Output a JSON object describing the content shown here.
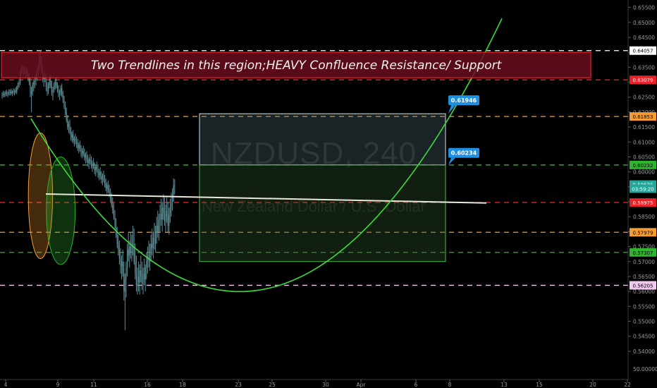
{
  "chart_data": {
    "type": "candlestick",
    "title": "NZDUSD, 240",
    "subtitle": "New Zealand Dollar / U.S. Dollar",
    "symbol": "NZDUSD",
    "interval": "240",
    "ylim": [
      0.5375,
      0.6575
    ],
    "y_scale_break_label": "50.00000",
    "y_ticks": [
      "0.65500",
      "0.65000",
      "0.64500",
      "0.64000",
      "0.63500",
      "0.63000",
      "0.62500",
      "0.62000",
      "0.61500",
      "0.61000",
      "0.60500",
      "0.60000",
      "0.59500",
      "0.59000",
      "0.58500",
      "0.58000",
      "0.57500",
      "0.57000",
      "0.56500",
      "0.56000",
      "0.55500",
      "0.55000",
      "0.54500",
      "0.54000"
    ],
    "x_ticks": [
      "4",
      "9",
      "11",
      "16",
      "18",
      "23",
      "25",
      "30",
      "Apr",
      "6",
      "8",
      "13",
      "15",
      "20",
      "22"
    ],
    "x_tick_bar_index": [
      0,
      30,
      46,
      77,
      93,
      123,
      139,
      169,
      185,
      215,
      231,
      261,
      277,
      307,
      323
    ],
    "grid": false,
    "price_labels": [
      {
        "text": "0.64057",
        "value": 0.64057,
        "bg": "#ffffff",
        "fg": "#000000"
      },
      {
        "text": "0.63079",
        "value": 0.63079,
        "bg": "#e8232a",
        "fg": "#ffffff"
      },
      {
        "text": "0.61853",
        "value": 0.61853,
        "bg": "#f39c34",
        "fg": "#000000"
      },
      {
        "text": "0.60232",
        "value": 0.60232,
        "bg": "#2eb52e",
        "fg": "#000000"
      },
      {
        "text": "0.59576",
        "value": 0.59576,
        "bg": "#26a69a",
        "fg": "#ffffff"
      },
      {
        "text": "03:59:20",
        "value": 0.5944,
        "bg": "#26a69a",
        "fg": "#ffffff"
      },
      {
        "text": "0.58975",
        "value": 0.58975,
        "bg": "#e8232a",
        "fg": "#ffffff"
      },
      {
        "text": "0.57979",
        "value": 0.57979,
        "bg": "#f39c34",
        "fg": "#000000"
      },
      {
        "text": "0.57307",
        "value": 0.57307,
        "bg": "#2eb52e",
        "fg": "#000000"
      },
      {
        "text": "0.56205",
        "value": 0.56205,
        "bg": "#f2c7f0",
        "fg": "#000000"
      }
    ],
    "horizontal_levels": [
      {
        "value": 0.64057,
        "color": "#ffffff"
      },
      {
        "value": 0.63079,
        "color": "#e8232a"
      },
      {
        "value": 0.61853,
        "color": "#f39c34"
      },
      {
        "value": 0.60232,
        "color": "#2eb52e"
      },
      {
        "value": 0.58975,
        "color": "#e8232a"
      },
      {
        "value": 0.57979,
        "color": "#f39c34"
      },
      {
        "value": 0.57307,
        "color": "#2eb52e"
      },
      {
        "value": 0.56205,
        "color": "#f2c7f0"
      }
    ],
    "banner": {
      "text": "Two Trendlines in this region;HEAVY Confluence Resistance/ Support",
      "top": 0.64,
      "bottom": 0.6315
    },
    "callouts": [
      {
        "text": "0.61946",
        "value": 0.61946
      },
      {
        "text": "0.60234",
        "value": 0.60234
      }
    ],
    "measure_box": {
      "top": 0.61946,
      "mid": 0.60234,
      "bottom": 0.57,
      "x0_bar": 116,
      "x1_bar": 228
    },
    "trendline": {
      "x0_bar": 13,
      "v0": 0.5926,
      "x1_bar": 244,
      "v1": 0.5896
    },
    "parabola": {
      "vertex_bar": 119,
      "vertex_value": 0.55995,
      "points": [
        [
          10,
          0.6178
        ],
        [
          228,
          0.61946
        ],
        [
          255,
          0.6575
        ]
      ]
    },
    "ellipses": [
      {
        "cx_bar": 9,
        "cy": 0.592,
        "rx_bars": 7,
        "ry": 0.021,
        "color": "#f39c34"
      },
      {
        "cx_bar": 27,
        "cy": 0.587,
        "rx_bars": 9,
        "ry": 0.018,
        "color": "#2eb52e"
      }
    ],
    "candles": {
      "ohlc": [
        [
          0.6255,
          0.6266,
          0.6245,
          0.626
        ],
        [
          0.626,
          0.6271,
          0.625,
          0.6258
        ],
        [
          0.6258,
          0.6268,
          0.6249,
          0.6262
        ],
        [
          0.6262,
          0.6272,
          0.6252,
          0.6264
        ],
        [
          0.6264,
          0.6275,
          0.6254,
          0.626
        ],
        [
          0.626,
          0.6269,
          0.625,
          0.6266
        ],
        [
          0.6266,
          0.6276,
          0.6256,
          0.6265
        ],
        [
          0.6265,
          0.6276,
          0.6255,
          0.6268
        ],
        [
          0.6268,
          0.6279,
          0.6258,
          0.6263
        ],
        [
          0.6263,
          0.6273,
          0.6253,
          0.627
        ],
        [
          0.627,
          0.628,
          0.626,
          0.6266
        ],
        [
          0.6266,
          0.6277,
          0.6256,
          0.6272
        ],
        [
          0.6272,
          0.6283,
          0.6262,
          0.6268
        ],
        [
          0.6268,
          0.6288,
          0.626,
          0.6285
        ],
        [
          0.6285,
          0.63,
          0.6275,
          0.629
        ],
        [
          0.629,
          0.6305,
          0.6282,
          0.6298
        ],
        [
          0.6298,
          0.6342,
          0.629,
          0.6335
        ],
        [
          0.6335,
          0.6352,
          0.632,
          0.6345
        ],
        [
          0.6345,
          0.636,
          0.633,
          0.6338
        ],
        [
          0.6338,
          0.6352,
          0.6322,
          0.6345
        ],
        [
          0.6345,
          0.6355,
          0.6325,
          0.633
        ],
        [
          0.633,
          0.6345,
          0.6315,
          0.634
        ],
        [
          0.634,
          0.635,
          0.632,
          0.6325
        ],
        [
          0.6325,
          0.6338,
          0.6305,
          0.6315
        ],
        [
          0.6315,
          0.633,
          0.629,
          0.63
        ],
        [
          0.63,
          0.6315,
          0.625,
          0.626
        ],
        [
          0.626,
          0.6285,
          0.62,
          0.627
        ],
        [
          0.627,
          0.63,
          0.6255,
          0.629
        ],
        [
          0.629,
          0.631,
          0.627,
          0.63
        ],
        [
          0.63,
          0.632,
          0.628,
          0.6305
        ],
        [
          0.6305,
          0.6335,
          0.629,
          0.6325
        ],
        [
          0.6325,
          0.6345,
          0.6305,
          0.6335
        ],
        [
          0.6335,
          0.636,
          0.632,
          0.635
        ],
        [
          0.635,
          0.64,
          0.634,
          0.639
        ],
        [
          0.639,
          0.6408,
          0.6355,
          0.637
        ],
        [
          0.637,
          0.6385,
          0.633,
          0.634
        ],
        [
          0.634,
          0.6355,
          0.63,
          0.631
        ],
        [
          0.631,
          0.633,
          0.6285,
          0.632
        ],
        [
          0.632,
          0.634,
          0.63,
          0.631
        ],
        [
          0.631,
          0.6325,
          0.627,
          0.6285
        ],
        [
          0.6285,
          0.63,
          0.6255,
          0.627
        ],
        [
          0.627,
          0.63,
          0.626,
          0.629
        ],
        [
          0.629,
          0.632,
          0.628,
          0.6305
        ],
        [
          0.6305,
          0.6325,
          0.628,
          0.629
        ],
        [
          0.629,
          0.6305,
          0.6255,
          0.6265
        ],
        [
          0.6265,
          0.6285,
          0.624,
          0.6275
        ],
        [
          0.6275,
          0.63,
          0.6265,
          0.629
        ],
        [
          0.629,
          0.6312,
          0.6275,
          0.63
        ],
        [
          0.63,
          0.6318,
          0.628,
          0.6288
        ],
        [
          0.6288,
          0.63,
          0.6265,
          0.6275
        ],
        [
          0.6275,
          0.629,
          0.625,
          0.626
        ],
        [
          0.626,
          0.6275,
          0.624,
          0.6265
        ],
        [
          0.6265,
          0.629,
          0.6255,
          0.628
        ],
        [
          0.628,
          0.6295,
          0.625,
          0.6255
        ],
        [
          0.6255,
          0.627,
          0.623,
          0.624
        ],
        [
          0.624,
          0.6255,
          0.621,
          0.622
        ],
        [
          0.622,
          0.6235,
          0.619,
          0.62
        ],
        [
          0.62,
          0.6215,
          0.6165,
          0.6175
        ],
        [
          0.6175,
          0.619,
          0.614,
          0.615
        ],
        [
          0.615,
          0.617,
          0.613,
          0.616
        ],
        [
          0.616,
          0.6175,
          0.6125,
          0.6135
        ],
        [
          0.6135,
          0.615,
          0.6105,
          0.6115
        ],
        [
          0.6115,
          0.6135,
          0.61,
          0.6125
        ],
        [
          0.6125,
          0.614,
          0.6095,
          0.6105
        ],
        [
          0.6105,
          0.612,
          0.6085,
          0.6112
        ],
        [
          0.6112,
          0.6128,
          0.6092,
          0.61
        ],
        [
          0.61,
          0.6118,
          0.608,
          0.6095
        ],
        [
          0.6095,
          0.611,
          0.607,
          0.608
        ],
        [
          0.608,
          0.6098,
          0.6062,
          0.609
        ],
        [
          0.609,
          0.6105,
          0.6068,
          0.6075
        ],
        [
          0.6075,
          0.609,
          0.605,
          0.606
        ],
        [
          0.606,
          0.608,
          0.6045,
          0.607
        ],
        [
          0.607,
          0.6088,
          0.6052,
          0.6062
        ],
        [
          0.6062,
          0.6078,
          0.6038,
          0.6048
        ],
        [
          0.6048,
          0.6065,
          0.6028,
          0.6055
        ],
        [
          0.6055,
          0.607,
          0.603,
          0.604
        ],
        [
          0.604,
          0.6058,
          0.6018,
          0.603
        ],
        [
          0.603,
          0.6048,
          0.601,
          0.6042
        ],
        [
          0.6042,
          0.606,
          0.6025,
          0.6035
        ],
        [
          0.6035,
          0.6052,
          0.6012,
          0.602
        ],
        [
          0.602,
          0.6038,
          0.6,
          0.603
        ],
        [
          0.603,
          0.6046,
          0.601,
          0.6015
        ],
        [
          0.6015,
          0.6032,
          0.5992,
          0.6005
        ],
        [
          0.6005,
          0.6024,
          0.5985,
          0.6018
        ],
        [
          0.6018,
          0.6034,
          0.5998,
          0.6008
        ],
        [
          0.6008,
          0.6025,
          0.598,
          0.599
        ],
        [
          0.599,
          0.601,
          0.5972,
          0.6
        ],
        [
          0.6,
          0.6015,
          0.5975,
          0.5985
        ],
        [
          0.5985,
          0.6002,
          0.5962,
          0.5975
        ],
        [
          0.5975,
          0.5995,
          0.5955,
          0.5988
        ],
        [
          0.5988,
          0.6004,
          0.5965,
          0.597
        ],
        [
          0.597,
          0.599,
          0.5948,
          0.596
        ],
        [
          0.596,
          0.5978,
          0.5935,
          0.5945
        ],
        [
          0.5945,
          0.5965,
          0.5925,
          0.5955
        ],
        [
          0.5955,
          0.5972,
          0.593,
          0.594
        ],
        [
          0.594,
          0.5958,
          0.5915,
          0.5925
        ],
        [
          0.5925,
          0.5945,
          0.59,
          0.591
        ],
        [
          0.591,
          0.593,
          0.588,
          0.589
        ],
        [
          0.589,
          0.5915,
          0.586,
          0.587
        ],
        [
          0.587,
          0.5895,
          0.584,
          0.585
        ],
        [
          0.585,
          0.5872,
          0.581,
          0.582
        ],
        [
          0.582,
          0.5845,
          0.578,
          0.579
        ],
        [
          0.579,
          0.5815,
          0.5745,
          0.576
        ],
        [
          0.576,
          0.579,
          0.572,
          0.574
        ],
        [
          0.574,
          0.577,
          0.569,
          0.571
        ],
        [
          0.571,
          0.5745,
          0.566,
          0.5685
        ],
        [
          0.5685,
          0.572,
          0.564,
          0.57
        ],
        [
          0.57,
          0.574,
          0.565,
          0.566
        ],
        [
          0.566,
          0.57,
          0.557,
          0.56
        ],
        [
          0.56,
          0.566,
          0.547,
          0.564
        ],
        [
          0.564,
          0.57,
          0.558,
          0.568
        ],
        [
          0.568,
          0.576,
          0.565,
          0.574
        ],
        [
          0.574,
          0.58,
          0.57,
          0.572
        ],
        [
          0.572,
          0.577,
          0.568,
          0.575
        ],
        [
          0.575,
          0.58,
          0.571,
          0.573
        ],
        [
          0.573,
          0.579,
          0.57,
          0.576
        ],
        [
          0.576,
          0.582,
          0.572,
          0.574
        ],
        [
          0.574,
          0.581,
          0.569,
          0.57
        ],
        [
          0.57,
          0.576,
          0.564,
          0.566
        ],
        [
          0.566,
          0.572,
          0.56,
          0.562
        ],
        [
          0.562,
          0.568,
          0.559,
          0.565
        ],
        [
          0.565,
          0.57,
          0.56,
          0.563
        ],
        [
          0.563,
          0.569,
          0.559,
          0.567
        ],
        [
          0.567,
          0.572,
          0.563,
          0.565
        ],
        [
          0.565,
          0.57,
          0.5605,
          0.5625
        ],
        [
          0.5625,
          0.568,
          0.559,
          0.566
        ],
        [
          0.566,
          0.571,
          0.562,
          0.564
        ],
        [
          0.564,
          0.569,
          0.56,
          0.568
        ],
        [
          0.568,
          0.573,
          0.564,
          0.57
        ],
        [
          0.57,
          0.575,
          0.566,
          0.572
        ],
        [
          0.572,
          0.577,
          0.568,
          0.57
        ],
        [
          0.57,
          0.576,
          0.567,
          0.574
        ],
        [
          0.574,
          0.579,
          0.57,
          0.576
        ],
        [
          0.576,
          0.581,
          0.572,
          0.5745
        ],
        [
          0.5745,
          0.58,
          0.571,
          0.578
        ],
        [
          0.578,
          0.583,
          0.574,
          0.576
        ],
        [
          0.576,
          0.582,
          0.573,
          0.58
        ],
        [
          0.58,
          0.585,
          0.576,
          0.582
        ],
        [
          0.582,
          0.587,
          0.578,
          0.58
        ],
        [
          0.58,
          0.586,
          0.577,
          0.584
        ],
        [
          0.584,
          0.589,
          0.58,
          0.586
        ],
        [
          0.586,
          0.591,
          0.582,
          0.584
        ],
        [
          0.584,
          0.59,
          0.58,
          0.588
        ],
        [
          0.588,
          0.5925,
          0.584,
          0.586
        ],
        [
          0.586,
          0.5915,
          0.582,
          0.5835
        ],
        [
          0.5835,
          0.589,
          0.58,
          0.587
        ],
        [
          0.587,
          0.592,
          0.583,
          0.585
        ],
        [
          0.585,
          0.59,
          0.58,
          0.582
        ],
        [
          0.582,
          0.588,
          0.579,
          0.586
        ],
        [
          0.586,
          0.591,
          0.583,
          0.588
        ],
        [
          0.588,
          0.593,
          0.585,
          0.59
        ],
        [
          0.59,
          0.5945,
          0.587,
          0.5925
        ],
        [
          0.5925,
          0.5978,
          0.59,
          0.5955
        ],
        [
          0.5955,
          0.5975,
          0.5925,
          0.5958
        ]
      ]
    }
  }
}
